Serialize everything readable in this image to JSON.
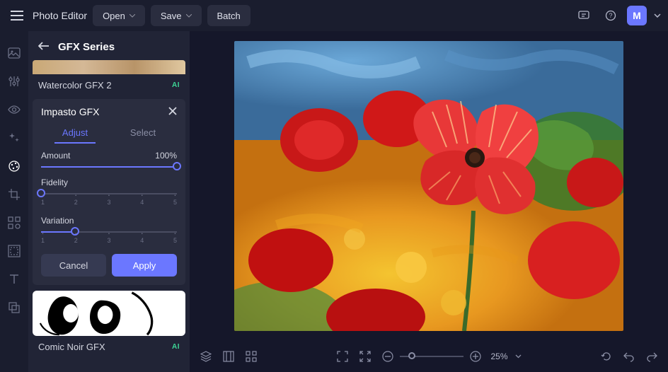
{
  "header": {
    "app_title": "Photo Editor",
    "open_label": "Open",
    "save_label": "Save",
    "batch_label": "Batch",
    "avatar_initial": "M"
  },
  "panel": {
    "title": "GFX Series",
    "prev_preset_name": "Watercolor GFX 2",
    "prev_ai": "AI",
    "effect_name": "Impasto GFX",
    "subtab_adjust": "Adjust",
    "subtab_select": "Select",
    "param_amount_label": "Amount",
    "param_amount_value": "100%",
    "param_fidelity_label": "Fidelity",
    "param_variation_label": "Variation",
    "ticks": [
      "1",
      "2",
      "3",
      "4",
      "5"
    ],
    "cancel_label": "Cancel",
    "apply_label": "Apply",
    "next_preset_name": "Comic Noir GFX",
    "next_ai": "AI"
  },
  "bottombar": {
    "zoom_label": "25%"
  }
}
